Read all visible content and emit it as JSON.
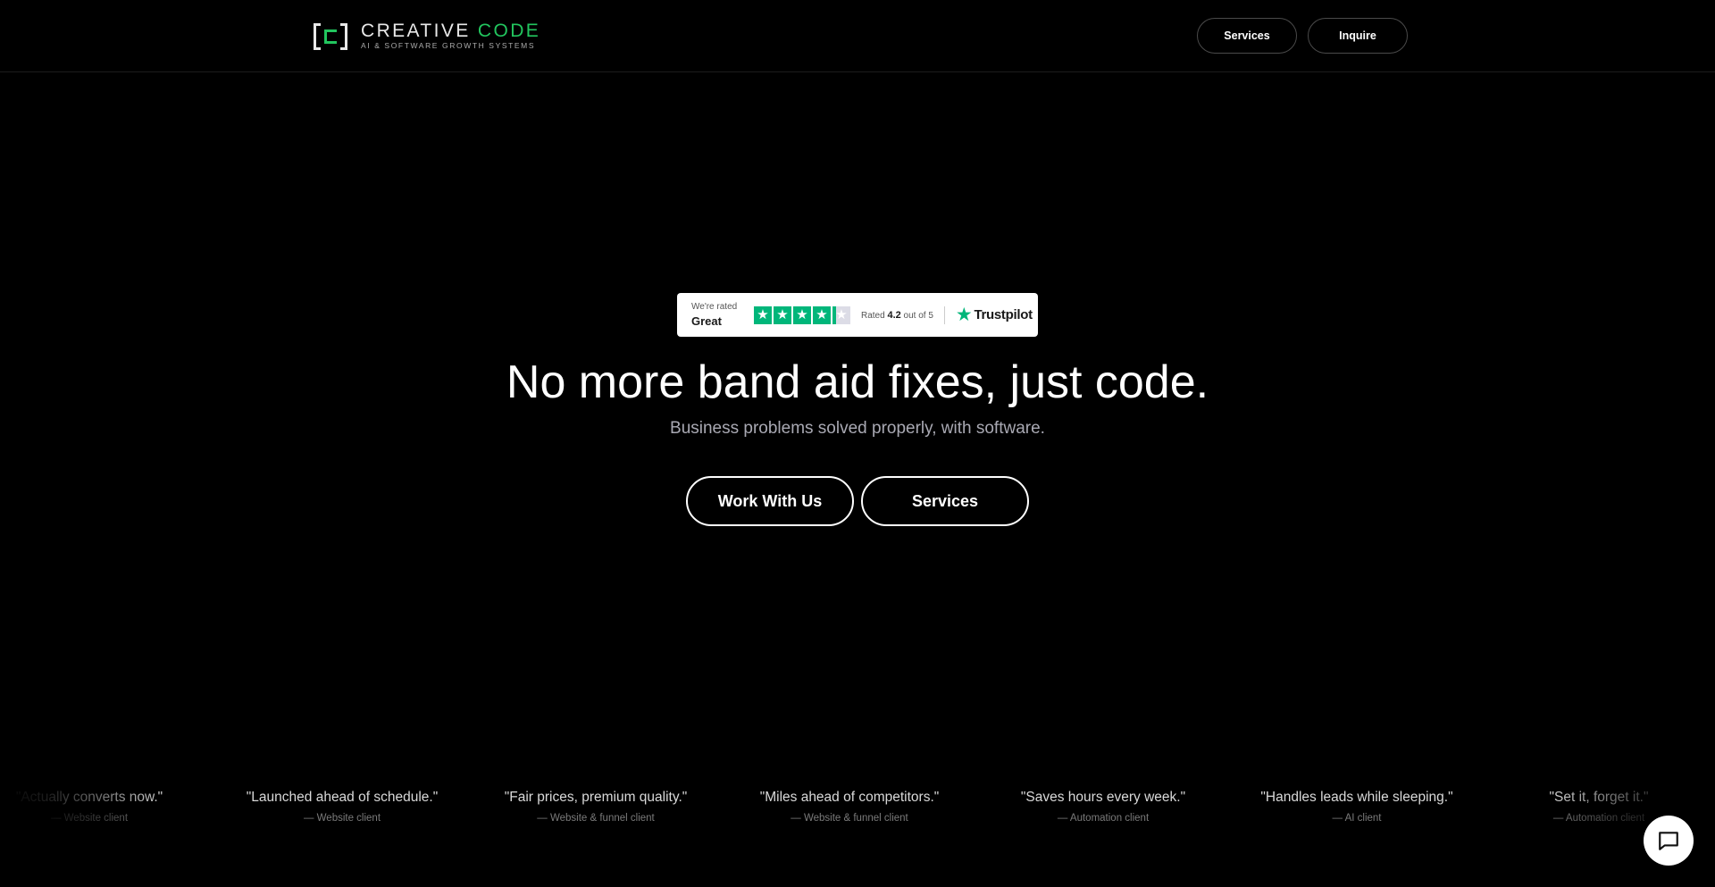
{
  "brand": {
    "name_primary": "CREATIVE",
    "name_accent": "CODE",
    "tagline": "AI & SOFTWARE GROWTH SYSTEMS"
  },
  "nav": {
    "services_label": "Services",
    "inquire_label": "Inquire"
  },
  "trustpilot": {
    "rated_prefix": "We're rated",
    "rating_word": "Great",
    "score_prefix": "Rated",
    "score": "4.2",
    "score_suffix": "out of 5",
    "brand": "Trustpilot",
    "stars_fraction": 0.84
  },
  "hero": {
    "headline": "No more band aid fixes, just code.",
    "subheadline": "Business problems solved properly, with software.",
    "primary_cta": "Work With Us",
    "secondary_cta": "Services"
  },
  "testimonials": [
    {
      "quote": "\"Actually converts now.\"",
      "author": "— Website client"
    },
    {
      "quote": "\"Launched ahead of schedule.\"",
      "author": "— Website client"
    },
    {
      "quote": "\"Fair prices, premium quality.\"",
      "author": "— Website & funnel client"
    },
    {
      "quote": "\"Miles ahead of competitors.\"",
      "author": "— Website & funnel client"
    },
    {
      "quote": "\"Saves hours every week.\"",
      "author": "— Automation client"
    },
    {
      "quote": "\"Handles leads while sleeping.\"",
      "author": "— AI client"
    },
    {
      "quote": "\"Set it, forget it.\"",
      "author": "— Automation client"
    }
  ],
  "colors": {
    "background": "#000000",
    "accent": "#22c55e",
    "trustpilot_green": "#00b67a"
  },
  "icons": {
    "chat": "chat-bubble-icon",
    "trustpilot_star": "star-icon"
  }
}
